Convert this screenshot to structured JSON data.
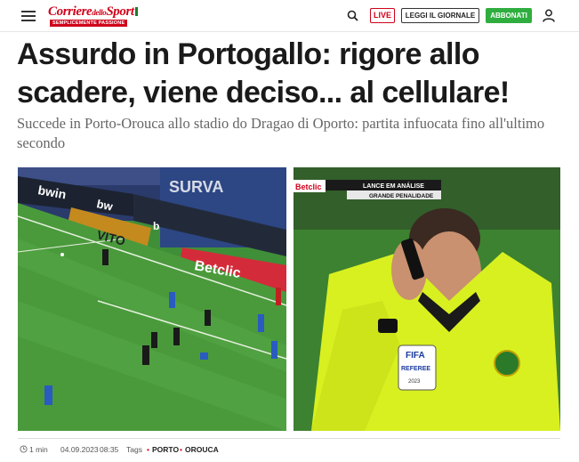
{
  "header": {
    "logo_main": "Corriere",
    "logo_small": "dello",
    "logo_end": "Sport",
    "logo_tagline": "SEMPLICEMENTE PASSIONE",
    "live_label": "LIVE",
    "leggi_label": "LEGGI IL GIORNALE",
    "abbonati_label": "ABBONATI"
  },
  "article": {
    "title": "Assurdo in Portogallo: rigore allo scadere, viene deciso... al cellulare!",
    "subtitle": "Succede in Porto-Orouca allo stadio do Dragao di Oporto: partita infuocata fino all'ultimo secondo",
    "left_photo": {
      "ads": [
        "bwin",
        "VITO",
        "Betclic",
        "bw",
        "b",
        "SURVA"
      ]
    },
    "right_photo": {
      "score_logo": "Betclic",
      "var_title": "LANCE EM ANÁLISE",
      "var_sub": "GRANDE PENALIDADE",
      "badge_fifa": "FIFA",
      "badge_referee": "REFEREE",
      "badge_year": "2023"
    }
  },
  "meta": {
    "read_time": "1 min",
    "date": "04.09.2023",
    "time": "08:35",
    "tags_label": "Tags",
    "tags": [
      "PORTO",
      "OROUCA"
    ]
  },
  "colors": {
    "brand_red": "#d0021b",
    "abbonati_green": "#2fae3f",
    "referee_yellow": "#d8f020"
  }
}
